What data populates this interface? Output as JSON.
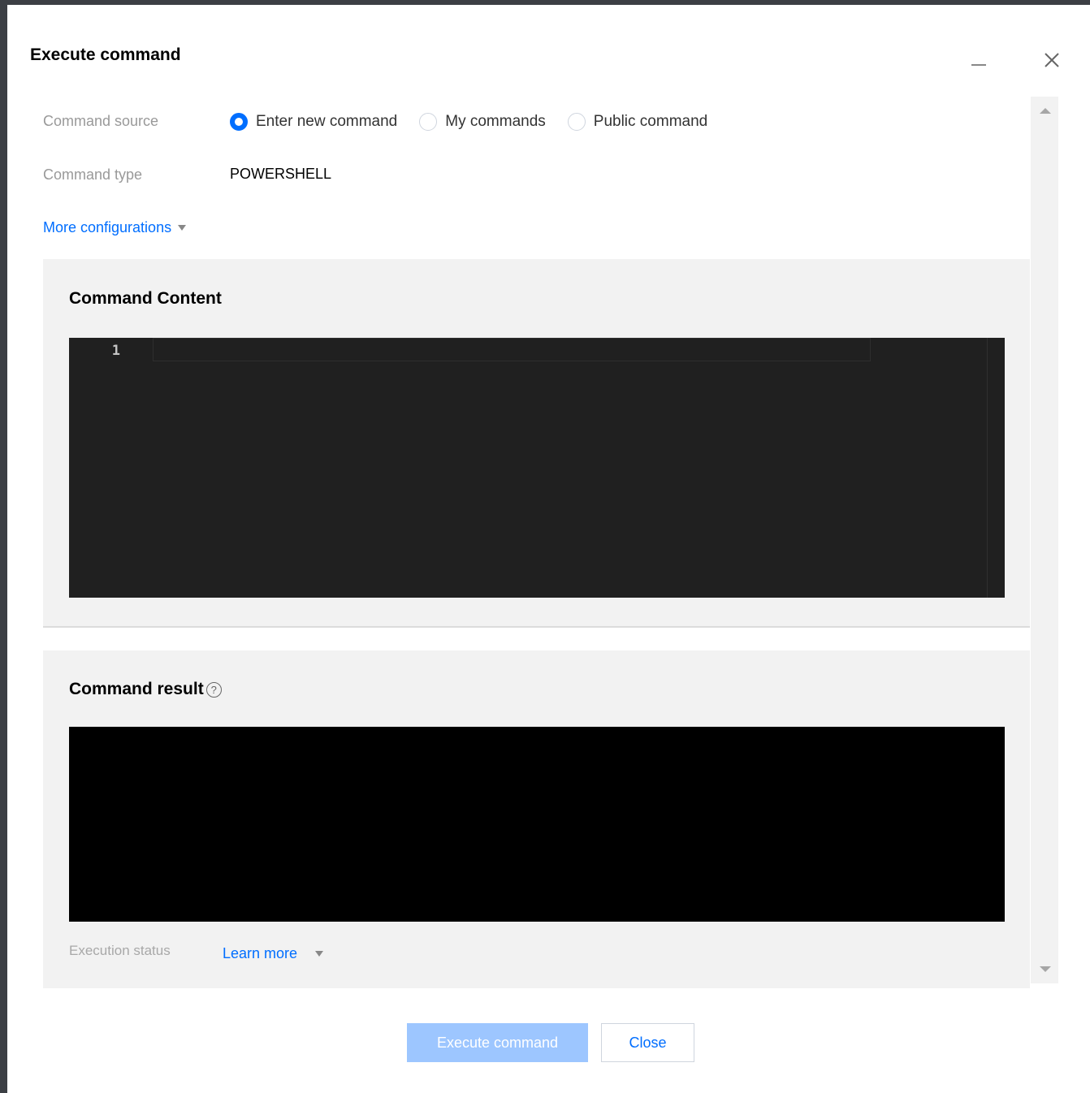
{
  "dialog": {
    "title": "Execute command"
  },
  "form": {
    "source_label": "Command source",
    "source_options": [
      {
        "label": "Enter new command",
        "selected": true
      },
      {
        "label": "My commands",
        "selected": false
      },
      {
        "label": "Public command",
        "selected": false
      }
    ],
    "type_label": "Command type",
    "type_value": "POWERSHELL",
    "more_config_label": "More configurations"
  },
  "content_section": {
    "title": "Command Content",
    "line_numbers": [
      "1"
    ]
  },
  "result_section": {
    "title": "Command result",
    "help_glyph": "?",
    "status_label": "Execution status",
    "learn_more_label": "Learn more"
  },
  "footer": {
    "execute_label": "Execute command",
    "close_label": "Close"
  },
  "colors": {
    "accent": "#006eff",
    "primary_disabled": "#9dc6ff",
    "section_bg": "#f2f2f2",
    "editor_bg": "#202020",
    "result_bg": "#000000"
  },
  "icons": {
    "minimize": "minimize-icon",
    "close": "close-icon",
    "caret": "caret-down-icon",
    "help": "help-icon"
  }
}
